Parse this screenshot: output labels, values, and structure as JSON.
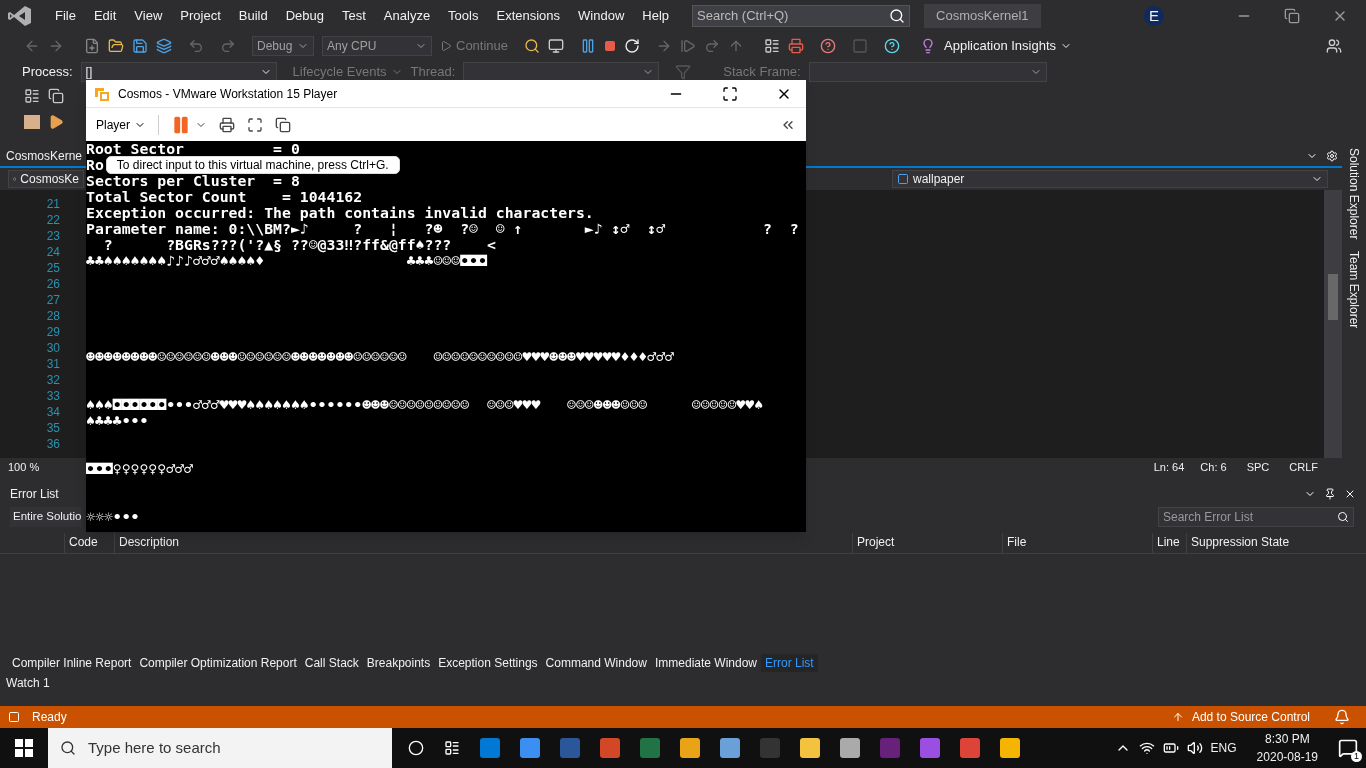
{
  "menu": [
    "File",
    "Edit",
    "View",
    "Project",
    "Build",
    "Debug",
    "Test",
    "Analyze",
    "Tools",
    "Extensions",
    "Window",
    "Help"
  ],
  "search": {
    "placeholder": "Search (Ctrl+Q)"
  },
  "solution_name": "CosmosKernel1",
  "account_initial": "E",
  "toolbar": {
    "configuration": "Debug",
    "platform": "Any CPU",
    "continue": "Continue",
    "insights": "Application Insights"
  },
  "debug_location": {
    "process_label": "Process:",
    "process_value": "[]",
    "lifecycle": "Lifecycle Events",
    "thread_label": "Thread:",
    "stack_frame_label": "Stack Frame:"
  },
  "document_tab": "CosmosKerne",
  "nav_bar": {
    "project": "CosmosKe",
    "member": "wallpaper"
  },
  "line_numbers": [
    "21",
    "22",
    "23",
    "24",
    "25",
    "26",
    "27",
    "28",
    "29",
    "30",
    "31",
    "32",
    "33",
    "34",
    "35",
    "36"
  ],
  "editor_status": {
    "zoom": "100 %",
    "line": "Ln: 64",
    "column": "Ch: 6",
    "indent": "SPC",
    "line_endings": "CRLF"
  },
  "side_tabs": [
    "Solution Explorer",
    "Team Explorer"
  ],
  "error_list": {
    "title": "Error List",
    "scope": "Entire Solutio",
    "search_placeholder": "Search Error List",
    "columns": [
      "Code",
      "Description",
      "Project",
      "File",
      "Line",
      "Suppression State"
    ]
  },
  "bottom_tabs": [
    {
      "label": "Compiler Inline Report",
      "selected": false
    },
    {
      "label": "Compiler Optimization Report",
      "selected": false
    },
    {
      "label": "Call Stack",
      "selected": false
    },
    {
      "label": "Breakpoints",
      "selected": false
    },
    {
      "label": "Exception Settings",
      "selected": false
    },
    {
      "label": "Command Window",
      "selected": false
    },
    {
      "label": "Immediate Window",
      "selected": false
    },
    {
      "label": "Error List",
      "selected": true
    }
  ],
  "watch_tab": "Watch 1",
  "status": {
    "text": "Ready",
    "source_control": "Add to Source Control"
  },
  "vm_window": {
    "title": "Cosmos - VMware Workstation 15 Player",
    "menu": "Player",
    "tooltip": "To direct input to this virtual machine, press Ctrl+G.",
    "console_top": "Root Sector          = 0",
    "console_beside_tooltip": "Ro",
    "console_rest": "Sectors per Cluster  = 8\nTotal Sector Count    = 1044162\nException occurred: The path contains invalid characters.\nParameter name: 0:\\\\BM?►♪     ?   ¦   ?☻  ?☺  ☺ ↑       ►♪ ↕♂  ↕♂           ?  ?\n  ?      ?BGRs???('?▲§ ??☺@33‼?ff&@ff♠???    <\n♣♣♠♠♠♠♠♠♠♪♪♪♂♂♂♠♠♠♠♦                ♣♣♣☺☺☺◘◘◘\n\n\n\n\n\n☻☻☻☻☻☻☻☻☺☺☺☺☺☺☻☻☻☺☺☺☺☺☺☻☻☻☻☻☻☻☺☺☺☺☺☺   ☺☺☺☺☺☺☺☺☺☺♥♥♥☻☻☻♥♥♥♥♥♦♦♦♂♂♂\n\n\n♠♠♠◘◘◘◘◘◘•••♂♂♂♥♥♥♠♠♠♠♠♠♠••••••☻☻☻☺☺☺☺☺☺☺☺☺  ☺☺☺♥♥♥   ☺☺☺☻☻☻☺☺☺     ☺☺☺☺☺♥♥♠\n♠♣♣♣•••\n\n\n◘◘◘♀♀♀♀♀♀♂♂♂\n\n\n☼☼☼•••"
  },
  "taskbar": {
    "search_placeholder": "Type here to search",
    "language": "ENG",
    "time": "8:30 PM",
    "date": "2020-08-19",
    "notifications": "1"
  }
}
